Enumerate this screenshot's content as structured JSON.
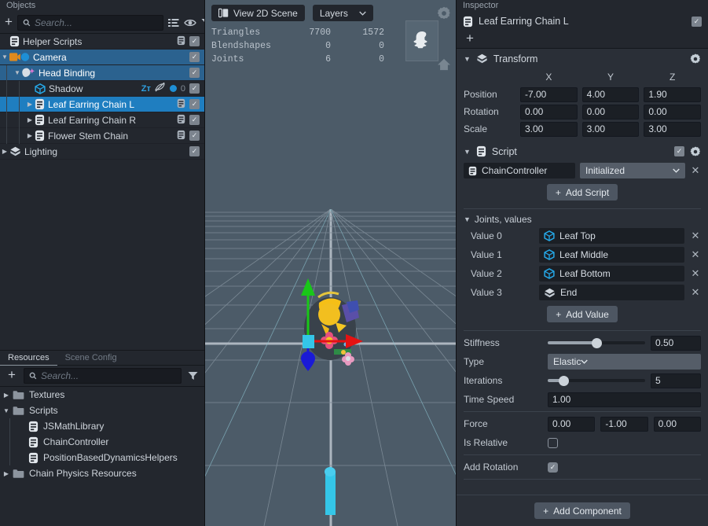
{
  "objects_panel": {
    "title": "Objects",
    "search_placeholder": "Search...",
    "add_label": "+",
    "icons": [
      "list-icon",
      "eye-icon",
      "filter-icon"
    ],
    "items": [
      {
        "label": "Helper Scripts",
        "depth": 0,
        "icon": "script-icon",
        "expandable": false,
        "selected": false,
        "right": {
          "script_badge": true,
          "checked": true
        }
      },
      {
        "label": "Camera",
        "depth": 0,
        "icon": "camera-icon",
        "expandable": true,
        "expanded": true,
        "selected": true,
        "right": {
          "checked": true
        }
      },
      {
        "label": "Head Binding",
        "depth": 1,
        "icon": "sparkle-icon",
        "expandable": true,
        "expanded": true,
        "selected": true,
        "right": {
          "checked": true
        }
      },
      {
        "label": "Shadow",
        "depth": 2,
        "icon": "cube-icon",
        "expandable": false,
        "selected": false,
        "right": {
          "ztest": "Zᴛ",
          "nodraw": true,
          "dot": true,
          "count": "0",
          "checked": true
        }
      },
      {
        "label": "Leaf Earring Chain L",
        "depth": 2,
        "icon": "script-icon",
        "expandable": true,
        "expanded": false,
        "selected": true,
        "active": true,
        "right": {
          "script_badge": true,
          "checked": true
        }
      },
      {
        "label": "Leaf Earring Chain R",
        "depth": 2,
        "icon": "script-icon",
        "expandable": true,
        "expanded": false,
        "selected": false,
        "right": {
          "script_badge": true,
          "checked": true
        }
      },
      {
        "label": "Flower Stem Chain",
        "depth": 2,
        "icon": "script-icon",
        "expandable": true,
        "expanded": false,
        "selected": false,
        "right": {
          "script_badge": true,
          "checked": true
        }
      },
      {
        "label": "Lighting",
        "depth": 0,
        "icon": "transform-icon",
        "expandable": true,
        "expanded": false,
        "selected": false,
        "right": {
          "checked": true
        }
      }
    ]
  },
  "resources_panel": {
    "tabs": [
      {
        "label": "Resources",
        "active": true
      },
      {
        "label": "Scene Config",
        "active": false
      }
    ],
    "search_placeholder": "Search...",
    "add_label": "+",
    "items": [
      {
        "label": "Textures",
        "type": "folder",
        "depth": 0,
        "expandable": true,
        "expanded": false
      },
      {
        "label": "Scripts",
        "type": "folder",
        "depth": 0,
        "expandable": true,
        "expanded": true
      },
      {
        "label": "JSMathLibrary",
        "type": "script",
        "depth": 1,
        "expandable": false
      },
      {
        "label": "ChainController",
        "type": "script",
        "depth": 1,
        "expandable": false
      },
      {
        "label": "PositionBasedDynamicsHelpers",
        "type": "script",
        "depth": 1,
        "expandable": false
      },
      {
        "label": "Chain Physics Resources",
        "type": "folder",
        "depth": 0,
        "expandable": true,
        "expanded": false
      }
    ]
  },
  "viewport": {
    "view_button": "View 2D Scene",
    "layers_dropdown": "Layers",
    "stats": {
      "rows": [
        {
          "label": "Triangles",
          "col1": "7700",
          "col2": "1572"
        },
        {
          "label": "Blendshapes",
          "col1": "0",
          "col2": "0"
        },
        {
          "label": "Joints",
          "col1": "6",
          "col2": "0"
        }
      ]
    },
    "preview_icon": "ghost-icon",
    "gear_icon": "gear-icon",
    "home_icon": "home-icon",
    "gizmo": {
      "y_axis_color": "#19c719",
      "x_axis_color": "#e41212",
      "z_axis_color": "#1a1ad6",
      "center_color": "#34c6e8"
    }
  },
  "inspector": {
    "title": "Inspector",
    "object_name": "Leaf Earring Chain L",
    "object_enabled": true,
    "add_label": "+",
    "transform": {
      "header": "Transform",
      "expanded": true,
      "columns": [
        "X",
        "Y",
        "Z"
      ],
      "rows": [
        {
          "label": "Position",
          "values": [
            "-7.00",
            "4.00",
            "1.90"
          ]
        },
        {
          "label": "Rotation",
          "values": [
            "0.00",
            "0.00",
            "0.00"
          ]
        },
        {
          "label": "Scale",
          "values": [
            "3.00",
            "3.00",
            "3.00"
          ]
        }
      ]
    },
    "script": {
      "header": "Script",
      "expanded": true,
      "enabled": true,
      "script_name": "ChainController",
      "state_dropdown": "Initialized",
      "add_script_label": "Add Script",
      "joints_header": "Joints, values",
      "joints_expanded": true,
      "joints": [
        {
          "label": "Value 0",
          "value": "Leaf Top",
          "icon": "cube-icon"
        },
        {
          "label": "Value 1",
          "value": "Leaf Middle",
          "icon": "cube-icon"
        },
        {
          "label": "Value 2",
          "value": "Leaf Bottom",
          "icon": "cube-icon"
        },
        {
          "label": "Value 3",
          "value": "End",
          "icon": "transform-icon"
        }
      ],
      "add_value_label": "Add Value",
      "properties": {
        "stiffness": {
          "label": "Stiffness",
          "value": "0.50",
          "slider_pct": 50
        },
        "type": {
          "label": "Type",
          "value": "Elastic"
        },
        "iterations": {
          "label": "Iterations",
          "value": "5",
          "slider_pct": 16
        },
        "time_speed": {
          "label": "Time Speed",
          "value": "1.00"
        },
        "force": {
          "label": "Force",
          "values": [
            "0.00",
            "-1.00",
            "0.00"
          ]
        },
        "is_relative": {
          "label": "Is Relative",
          "checked": false
        },
        "add_rotation": {
          "label": "Add Rotation",
          "checked": true
        }
      }
    },
    "add_component_label": "Add Component"
  },
  "colors": {
    "accent_blue": "#1f7ec0",
    "selection_blue": "#2b628f",
    "panel_dark": "#23272e",
    "inspector_bg": "#2a2f37",
    "viewport_bg": "#4c5b68"
  }
}
